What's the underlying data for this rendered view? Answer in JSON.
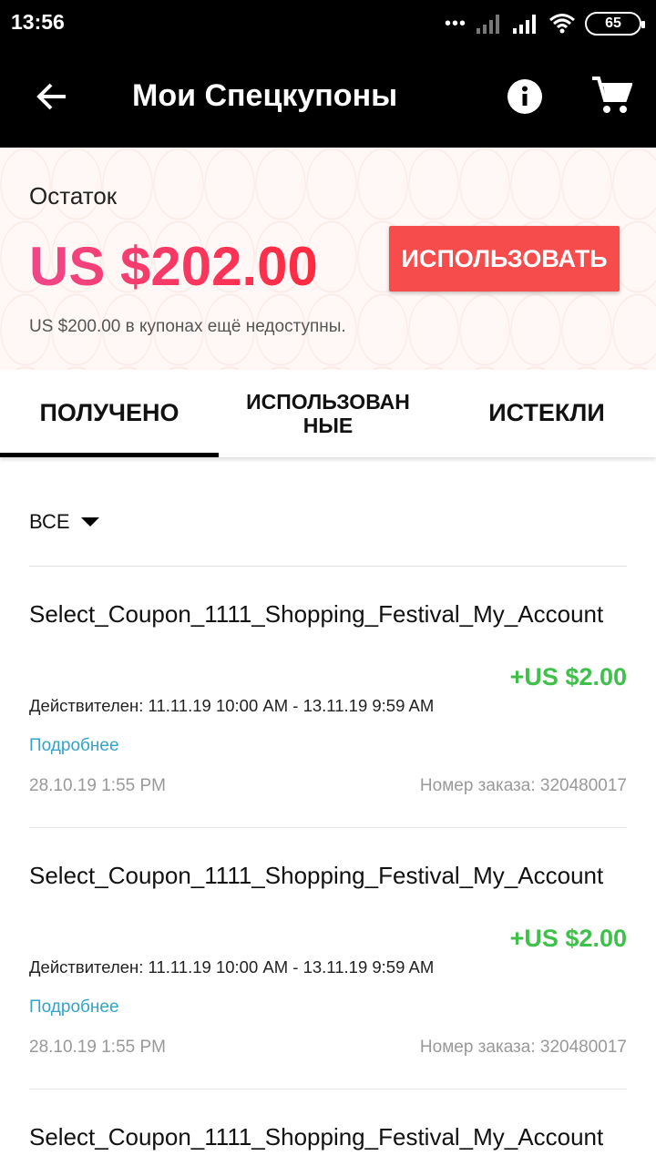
{
  "status_bar": {
    "time": "13:56",
    "battery": "65"
  },
  "app_bar": {
    "title": "Мои Спецкупоны"
  },
  "balance": {
    "label": "Остаток",
    "amount": "US $202.00",
    "use_button": "ИСПОЛЬЗОВАТЬ",
    "note": "US $200.00 в купонах ещё недоступны."
  },
  "tabs": [
    {
      "label": "ПОЛУЧЕНО",
      "active": true
    },
    {
      "label": "ИСПОЛЬЗОВАН НЫЕ",
      "active": false
    },
    {
      "label": "ИСТЕКЛИ",
      "active": false
    }
  ],
  "filter": {
    "label": "ВСЕ"
  },
  "coupons": [
    {
      "name": "Select_Coupon_1111_Shopping_Festival_My_Account",
      "amount": "+US $2.00",
      "valid": "Действителен: 11.11.19 10:00 AM - 13.11.19 9:59 AM",
      "more": "Подробнее",
      "date": "28.10.19 1:55 PM",
      "order": "Номер заказа: 320480017"
    },
    {
      "name": "Select_Coupon_1111_Shopping_Festival_My_Account",
      "amount": "+US $2.00",
      "valid": "Действителен: 11.11.19 10:00 AM - 13.11.19 9:59 AM",
      "more": "Подробнее",
      "date": "28.10.19 1:55 PM",
      "order": "Номер заказа: 320480017"
    },
    {
      "name": "Select_Coupon_1111_Shopping_Festival_My_Account",
      "amount": "",
      "valid": "",
      "more": "",
      "date": "",
      "order": ""
    }
  ],
  "colors": {
    "accent_red": "#f74c4c",
    "amount_green": "#3ec04a",
    "link_blue": "#33a3c8"
  },
  "icons": [
    "back-arrow-icon",
    "info-icon",
    "cart-icon",
    "signal-icon",
    "wifi-icon",
    "battery-icon",
    "caret-down-icon"
  ]
}
